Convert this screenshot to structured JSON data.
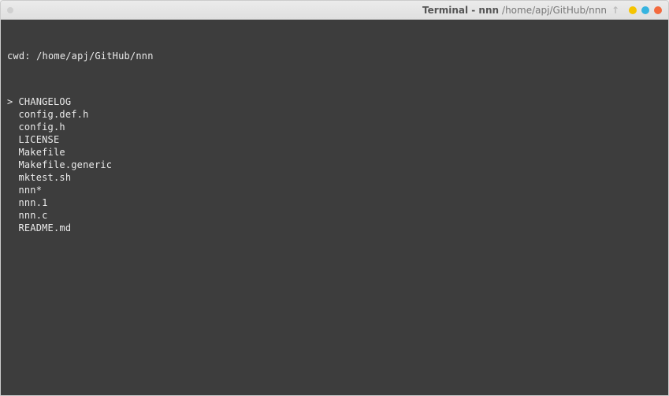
{
  "titlebar": {
    "app_label": "Terminal - nnn",
    "path_label": "/home/apj/GitHub/nnn",
    "arrow_icon": "↑"
  },
  "terminal": {
    "cwd_prefix": "cwd: ",
    "cwd_path": "/home/apj/GitHub/nnn",
    "caret": ">",
    "files": [
      "CHANGELOG",
      "config.def.h",
      "config.h",
      "LICENSE",
      "Makefile",
      "Makefile.generic",
      "mktest.sh",
      "nnn*",
      "nnn.1",
      "nnn.c",
      "README.md"
    ],
    "selected_index": 0
  },
  "colors": {
    "terminal_bg": "#3d3d3d",
    "terminal_fg": "#eaeaea"
  }
}
